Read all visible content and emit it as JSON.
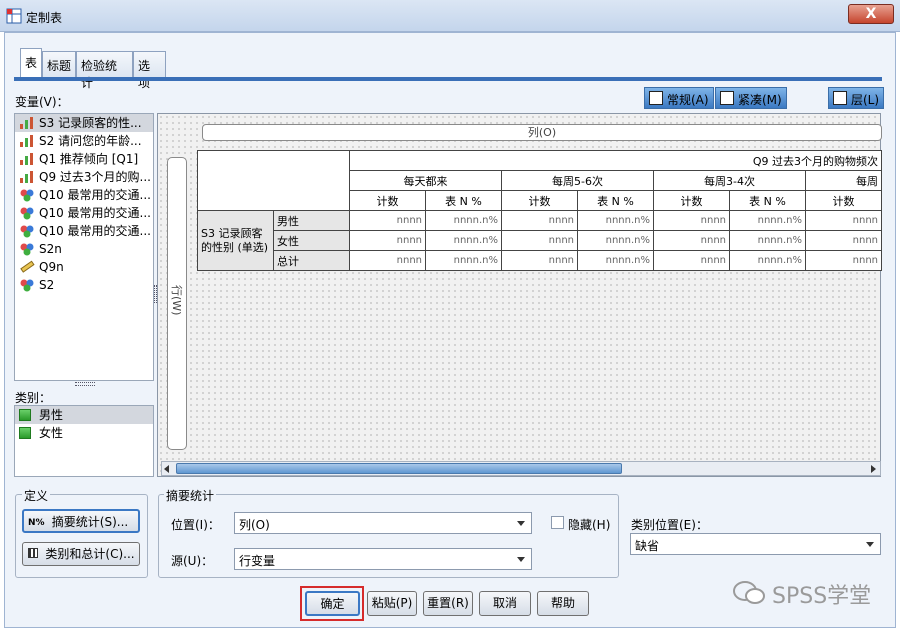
{
  "window": {
    "title": "定制表",
    "close_glyph": "X"
  },
  "tabs": [
    "表",
    "标题",
    "检验统计",
    "选项"
  ],
  "variables_label": "变量(V)：",
  "variables": [
    {
      "label": "S3 记录顾客的性...",
      "icon": "bar-chart-icon",
      "selected": true
    },
    {
      "label": "S2 请问您的年龄...",
      "icon": "bar-chart-icon"
    },
    {
      "label": "Q1 推荐倾向 [Q1]",
      "icon": "bar-chart-icon"
    },
    {
      "label": "Q9 过去3个月的购...",
      "icon": "bar-chart-icon"
    },
    {
      "label": "Q10 最常用的交通...",
      "icon": "nominal-icon"
    },
    {
      "label": "Q10 最常用的交通...",
      "icon": "nominal-icon"
    },
    {
      "label": "Q10 最常用的交通...",
      "icon": "nominal-icon"
    },
    {
      "label": "S2n",
      "icon": "nominal-icon"
    },
    {
      "label": "Q9n",
      "icon": "ruler-icon"
    },
    {
      "label": "S2",
      "icon": "nominal-icon"
    }
  ],
  "category_label": "类别：",
  "categories": [
    "男性",
    "女性"
  ],
  "view_buttons": {
    "normal": "常规(A)",
    "compact": "紧凑(M)",
    "layers": "层(L)"
  },
  "canvas": {
    "columns_label": "列(O)",
    "rows_label": "行(W)",
    "col_var": "Q9 过去3个月的购物频次",
    "col_cats": [
      "每天都来",
      "每周5-6次",
      "每周3-4次",
      "每周"
    ],
    "stats": [
      "计数",
      "表 N %"
    ],
    "row_var": "S3 记录顾客的性别 (单选)",
    "row_cats": [
      "男性",
      "女性",
      "总计"
    ],
    "count_cell": "nnnn",
    "pct_cell": "nnnn.n%"
  },
  "define": {
    "legend": "定义",
    "summary_btn": "摘要统计(S)...",
    "cat_btn": "类别和总计(C)...",
    "summary_icon": "N%"
  },
  "summary": {
    "legend": "摘要统计",
    "position_label": "位置(I)：",
    "position_value": "列(O)",
    "source_label": "源(U)：",
    "source_value": "行变量",
    "hide_label": "隐藏(H)"
  },
  "cat_position": {
    "label": "类别位置(E)：",
    "value": "缺省"
  },
  "footer": [
    "确定",
    "粘贴(P)",
    "重置(R)",
    "取消",
    "帮助"
  ],
  "watermark": "SPSS学堂",
  "colors": {
    "accent": "#3a6fb7",
    "highlight": "#d62b2b"
  }
}
